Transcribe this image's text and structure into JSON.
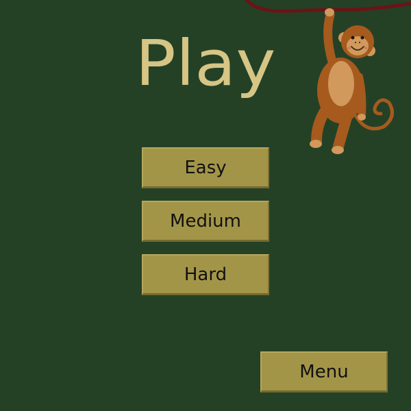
{
  "title": "Play",
  "difficulty_buttons": [
    {
      "id": "easy",
      "label": "Easy"
    },
    {
      "id": "medium",
      "label": "Medium"
    },
    {
      "id": "hard",
      "label": "Hard"
    }
  ],
  "menu_button": {
    "label": "Menu"
  },
  "decoration": {
    "monkey_icon": "monkey-hanging-from-vine-icon"
  },
  "colors": {
    "background": "#244126",
    "title": "#d6c585",
    "button_fill": "#a39548",
    "button_text": "#111111",
    "vine": "#6b1416",
    "monkey_fur": "#a65a1e",
    "monkey_face": "#d1995b"
  }
}
